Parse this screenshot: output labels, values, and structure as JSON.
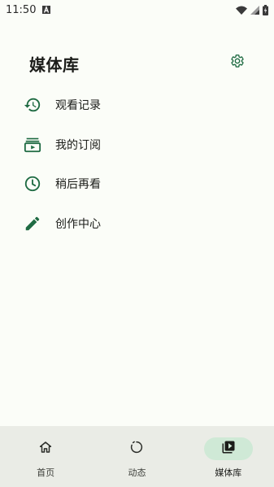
{
  "status_bar": {
    "time": "11:50",
    "icons": [
      "notification-a-icon",
      "wifi-icon",
      "signal-icon",
      "battery-icon"
    ]
  },
  "header": {
    "title": "媒体库",
    "settings_icon": "gear-icon"
  },
  "menu": {
    "items": [
      {
        "label": "观看记录",
        "icon": "history-icon"
      },
      {
        "label": "我的订阅",
        "icon": "subscriptions-icon"
      },
      {
        "label": "稍后再看",
        "icon": "clock-icon"
      },
      {
        "label": "创作中心",
        "icon": "pencil-icon"
      }
    ]
  },
  "bottom_nav": {
    "items": [
      {
        "label": "首页",
        "icon": "home-icon",
        "active": false
      },
      {
        "label": "动态",
        "icon": "refresh-circle-icon",
        "active": false
      },
      {
        "label": "媒体库",
        "icon": "video-library-icon",
        "active": true
      }
    ]
  },
  "colors": {
    "accent": "#1f6b43",
    "background": "#fbfdf8",
    "nav_background": "#eaece6",
    "active_pill": "#cfe9d6"
  }
}
